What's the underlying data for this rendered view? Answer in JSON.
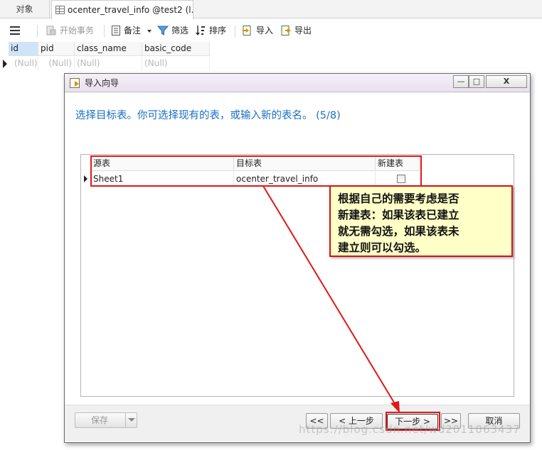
{
  "tabs": {
    "objects": "对象",
    "table": "ocenter_travel_info @test2 (l..."
  },
  "toolbar": {
    "begin_transaction": "开始事务",
    "notes": "备注",
    "filter": "筛选",
    "sort": "排序",
    "import": "导入",
    "export": "导出"
  },
  "grid": {
    "columns": [
      "id",
      "pid",
      "class_name",
      "basic_code"
    ],
    "row": [
      "(Null)",
      "(Null)",
      "(Null)",
      "(Null)"
    ]
  },
  "dialog": {
    "title": "导入向导",
    "window_controls": {
      "minimize": "—",
      "maximize": "□",
      "close": "X"
    },
    "heading": "选择目标表。你可选择现有的表，或输入新的表名。 (5/8)",
    "table": {
      "headers": [
        "源表",
        "目标表",
        "新建表"
      ],
      "rows": [
        {
          "source": "Sheet1",
          "target": "ocenter_travel_info",
          "new_table": false
        }
      ]
    },
    "buttons": {
      "save": "保存",
      "first": "<<",
      "prev": "< 上一步",
      "next": "下一步 >",
      "last": ">>",
      "cancel": "取消"
    }
  },
  "annotation": {
    "callout": "根据自己的需要考虑是否\n新建表：如果该表已建立\n就无需勾选，如果该表未\n建立则可以勾选。",
    "color": "#e01818"
  },
  "watermark": "https://blog.csdn.net/wd2011063437",
  "colors": {
    "heading": "#1a6fc4",
    "callout_bg": "#ffffc8",
    "selected_column": "#cfe4f6"
  }
}
